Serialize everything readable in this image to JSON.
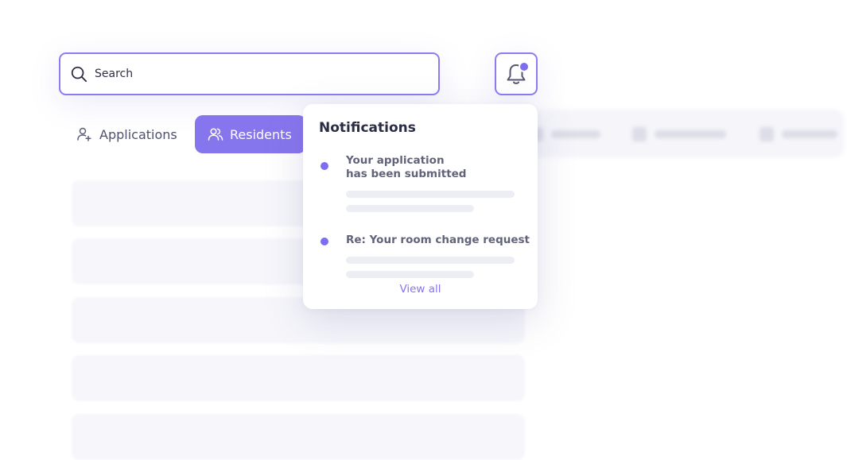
{
  "search": {
    "placeholder": "Search"
  },
  "notifications_button": {
    "icon": "bell-icon",
    "has_unread": true
  },
  "tabs": [
    {
      "label": "Applications",
      "icon": "user-plus-icon",
      "active": false
    },
    {
      "label": "Residents",
      "icon": "users-icon",
      "active": true
    }
  ],
  "notifications": {
    "title": "Notifications",
    "items": [
      {
        "line1": "Your application",
        "line2": "has been submitted"
      },
      {
        "line1": "Re: Your room change request",
        "line2": ""
      }
    ],
    "view_all": "View all"
  },
  "colors": {
    "accent": "#8676ee",
    "accent_dark": "#7d6ef0",
    "text": "#2b2d45",
    "muted": "#61637a"
  }
}
